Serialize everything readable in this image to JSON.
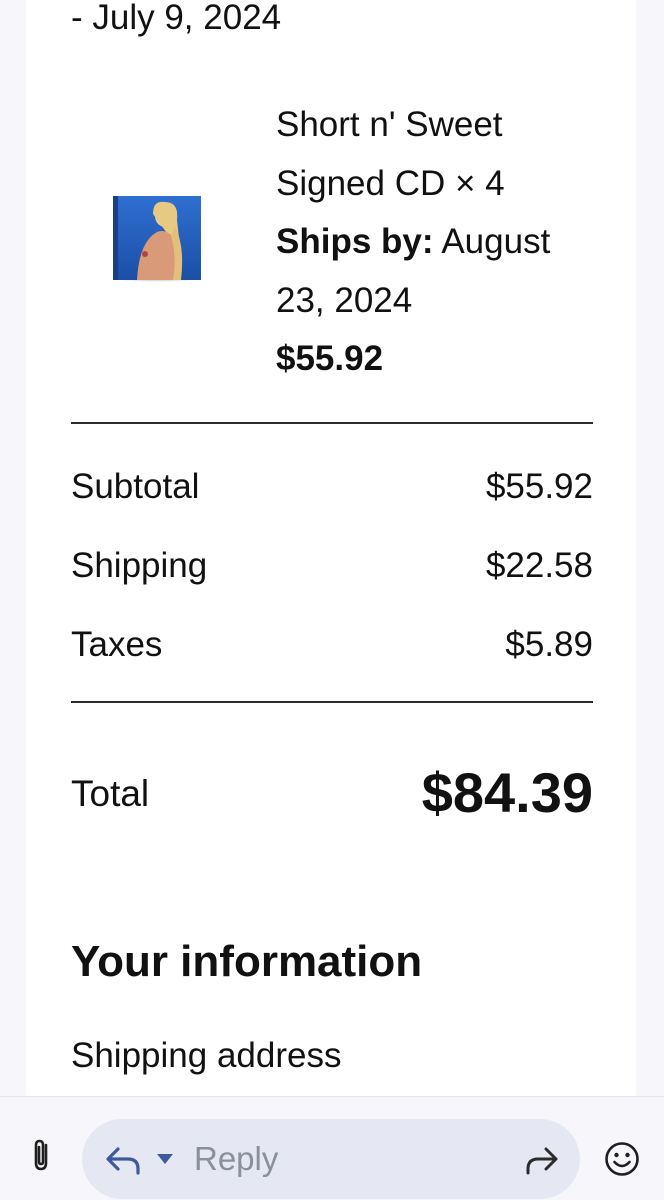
{
  "order": {
    "date_fragment": "- July 9, 2024",
    "item": {
      "name_line1": "Short n' Sweet",
      "name_line2": "Signed CD × 4",
      "ships_by_label": "Ships by:",
      "ships_by_value_line1": "August",
      "ships_by_value_line2": "23, 2024",
      "price": "$55.92",
      "thumbnail_icon": "album-cover-thumbnail"
    },
    "summary": [
      {
        "label": "Subtotal",
        "value": "$55.92"
      },
      {
        "label": "Shipping",
        "value": "$22.58"
      },
      {
        "label": "Taxes",
        "value": "$5.89"
      }
    ],
    "total": {
      "label": "Total",
      "value": "$84.39"
    }
  },
  "info": {
    "heading": "Your information",
    "shipping_address_label": "Shipping address"
  },
  "reply_bar": {
    "placeholder": "Reply",
    "attach_icon": "paperclip-icon",
    "reply_icon": "reply-arrow-icon",
    "forward_icon": "forward-arrow-icon",
    "emoji_icon": "emoji-icon",
    "accent_color": "#3d5b9a"
  }
}
